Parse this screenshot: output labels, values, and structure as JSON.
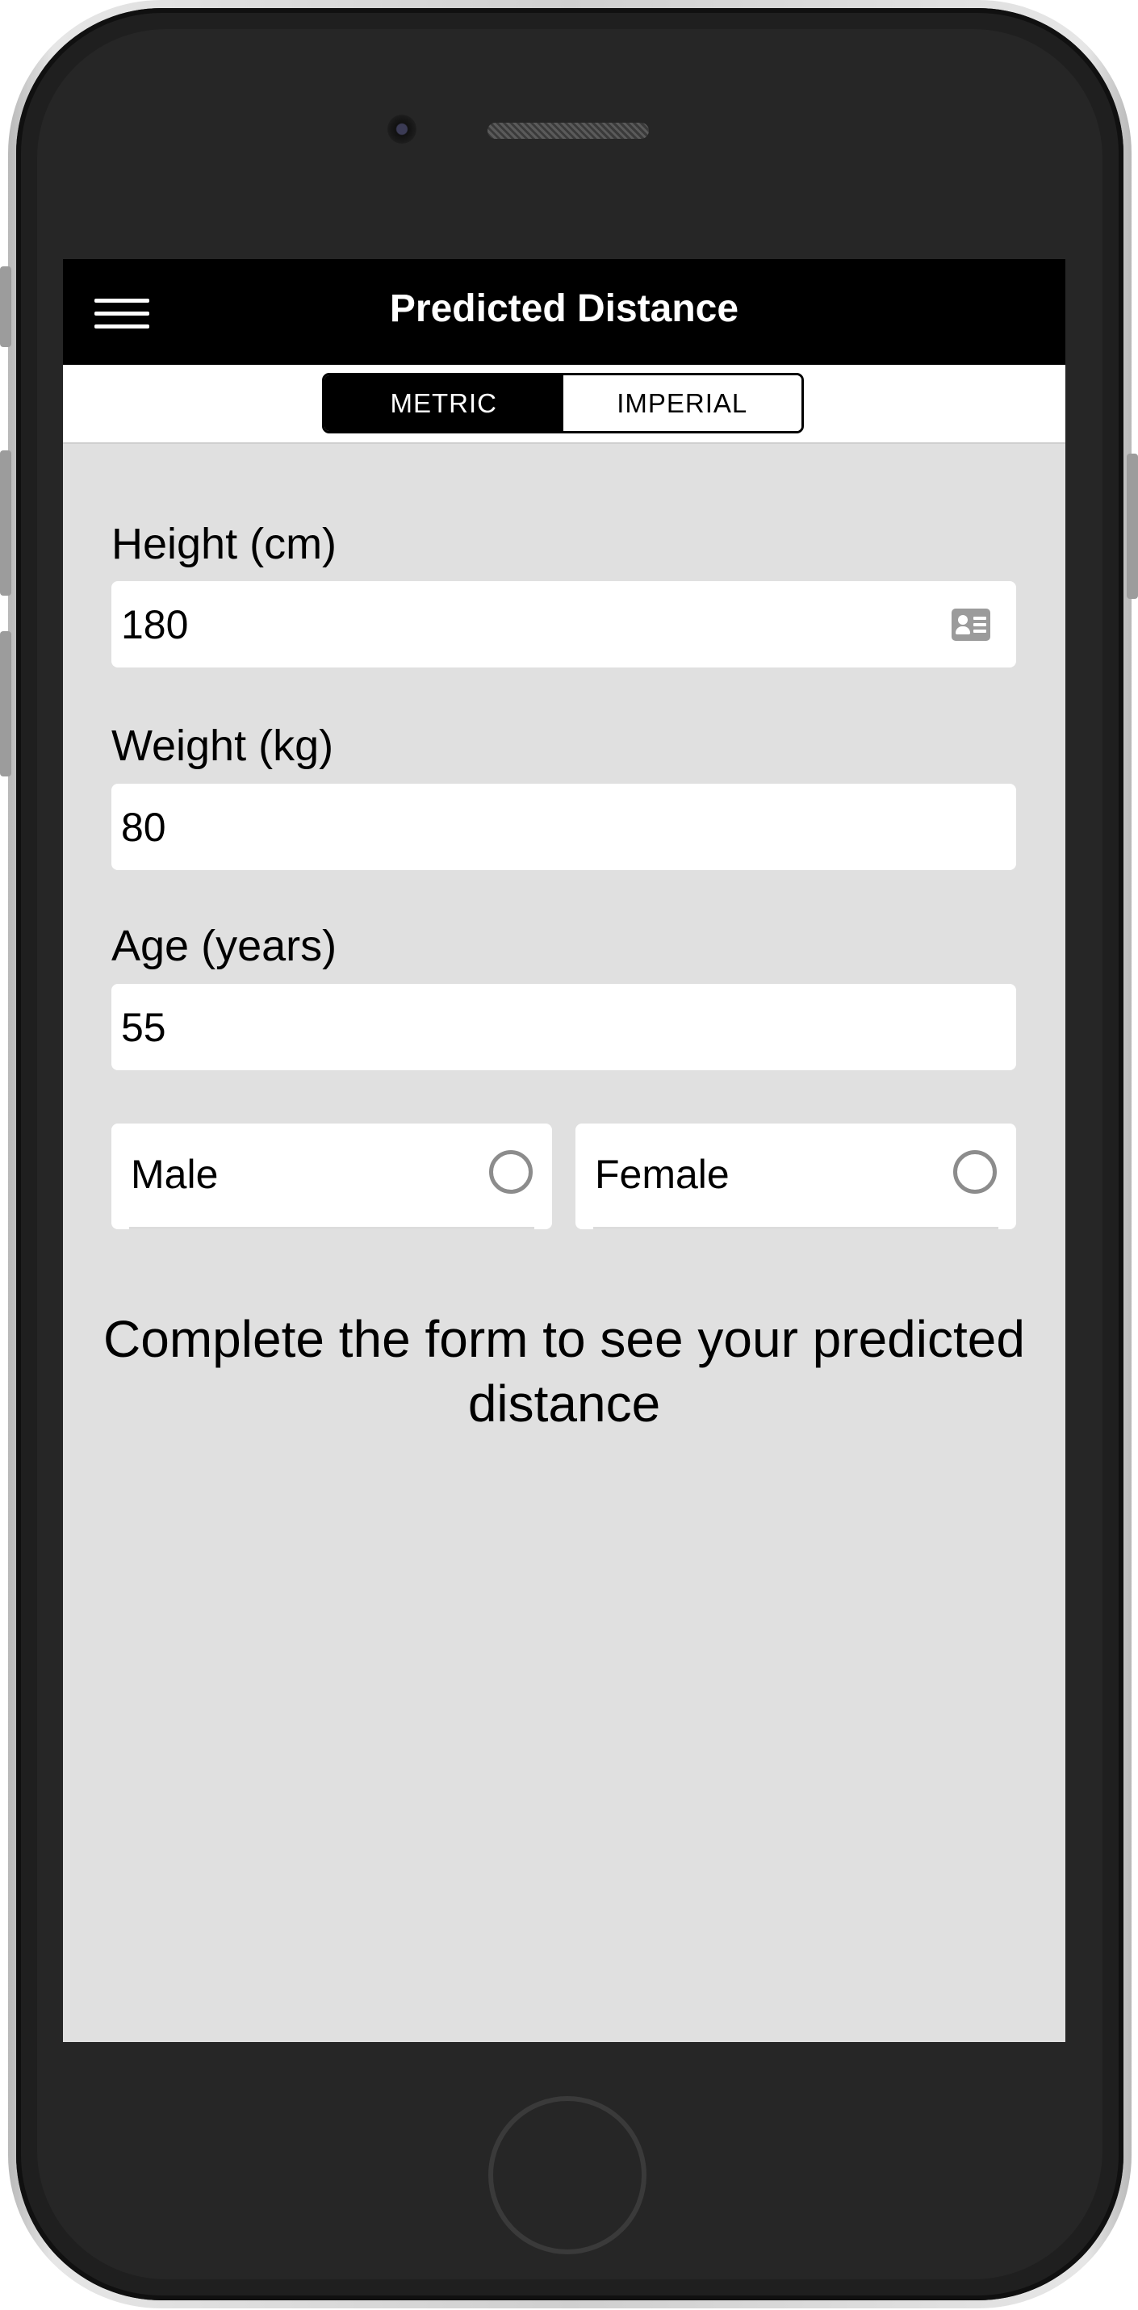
{
  "navbar": {
    "title": "Predicted Distance",
    "menu_icon": "hamburger-menu-icon"
  },
  "units_toggle": {
    "options": [
      "METRIC",
      "IMPERIAL"
    ],
    "selected": "METRIC"
  },
  "form": {
    "height": {
      "label": "Height (cm)",
      "value": "180",
      "icon": "contact-card-icon"
    },
    "weight": {
      "label": "Weight (kg)",
      "value": "80"
    },
    "age": {
      "label": "Age (years)",
      "value": "55"
    },
    "gender_options": [
      {
        "label": "Male",
        "selected": false
      },
      {
        "label": "Female",
        "selected": false
      }
    ]
  },
  "result": {
    "message": "Complete the form to see your predicted distance"
  },
  "colors": {
    "navbar_bg": "#000000",
    "screen_bg": "#e0e0e0",
    "input_bg": "#ffffff",
    "radio_border": "#8c8c8c"
  }
}
